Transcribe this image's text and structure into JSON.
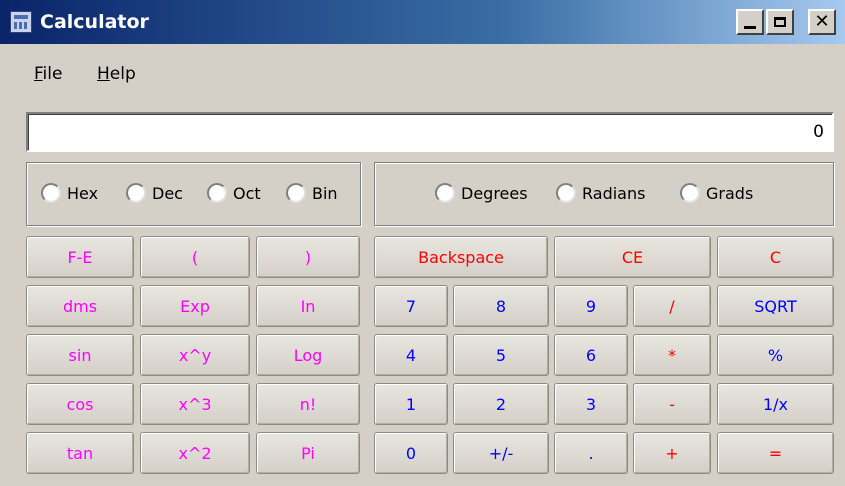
{
  "window": {
    "title": "Calculator"
  },
  "menu": [
    {
      "underline": "F",
      "rest": "ile"
    },
    {
      "underline": "H",
      "rest": "elp"
    }
  ],
  "display": {
    "value": "0"
  },
  "base_options": [
    "Hex",
    "Dec",
    "Oct",
    "Bin"
  ],
  "angle_options": [
    "Degrees",
    "Radians",
    "Grads"
  ],
  "keys": {
    "fe": "F-E",
    "lparen": "(",
    "rparen": ")",
    "backspace": "Backspace",
    "ce": "CE",
    "c": "C",
    "dms": "dms",
    "exp": "Exp",
    "ln": "In",
    "n7": "7",
    "n8": "8",
    "n9": "9",
    "div": "/",
    "sqrt": "SQRT",
    "sin": "sin",
    "xy": "x^y",
    "log": "Log",
    "n4": "4",
    "n5": "5",
    "n6": "6",
    "mul": "*",
    "pct": "%",
    "cos": "cos",
    "x3": "x^3",
    "fact": "n!",
    "n1": "1",
    "n2": "2",
    "n3": "3",
    "sub": "-",
    "recip": "1/x",
    "tan": "tan",
    "x2": "x^2",
    "pi": "Pi",
    "n0": "0",
    "sign": "+/-",
    "dot": ".",
    "add": "+",
    "eq": "="
  },
  "colors": {
    "function": "#ff00ff",
    "digit": "#0000ff",
    "operator": "#ff0000"
  }
}
